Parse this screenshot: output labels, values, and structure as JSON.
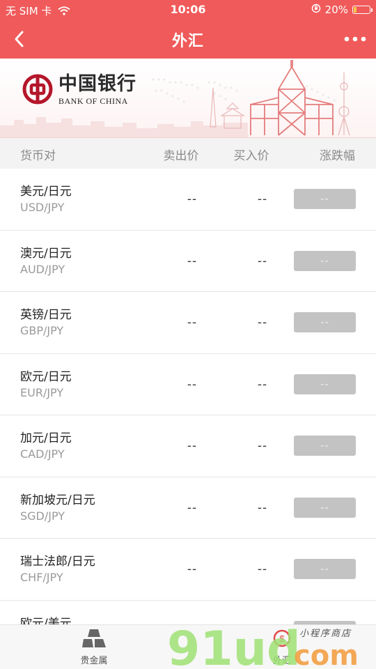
{
  "status_bar": {
    "carrier": "无 SIM 卡",
    "time": "10:06",
    "battery": "20%",
    "battery_level": 0.2
  },
  "nav": {
    "title": "外汇"
  },
  "banner": {
    "logo_cn": "中国银行",
    "logo_en": "BANK OF CHINA"
  },
  "table": {
    "headers": {
      "pair": "货币对",
      "sell": "卖出价",
      "buy": "买入价",
      "change": "涨跌幅"
    },
    "rows": [
      {
        "name": "美元/日元",
        "code": "USD/JPY",
        "sell": "--",
        "buy": "--",
        "change": "--"
      },
      {
        "name": "澳元/日元",
        "code": "AUD/JPY",
        "sell": "--",
        "buy": "--",
        "change": "--"
      },
      {
        "name": "英镑/日元",
        "code": "GBP/JPY",
        "sell": "--",
        "buy": "--",
        "change": "--"
      },
      {
        "name": "欧元/日元",
        "code": "EUR/JPY",
        "sell": "--",
        "buy": "--",
        "change": "--"
      },
      {
        "name": "加元/日元",
        "code": "CAD/JPY",
        "sell": "--",
        "buy": "--",
        "change": "--"
      },
      {
        "name": "新加坡元/日元",
        "code": "SGD/JPY",
        "sell": "--",
        "buy": "--",
        "change": "--"
      },
      {
        "name": "瑞士法郎/日元",
        "code": "CHF/JPY",
        "sell": "--",
        "buy": "--",
        "change": "--"
      },
      {
        "name": "欧元/美元",
        "code": "",
        "sell": "--",
        "buy": "--",
        "change": "--"
      }
    ]
  },
  "tabs": {
    "precious_metals": "贵金属",
    "forex": "外汇"
  },
  "watermark": {
    "brand": "9ludcom",
    "tagline": "小程序商店"
  },
  "colors": {
    "primary": "#f05a5a",
    "badge": "#c3c3c3",
    "header_bg": "#f3f3f3"
  }
}
